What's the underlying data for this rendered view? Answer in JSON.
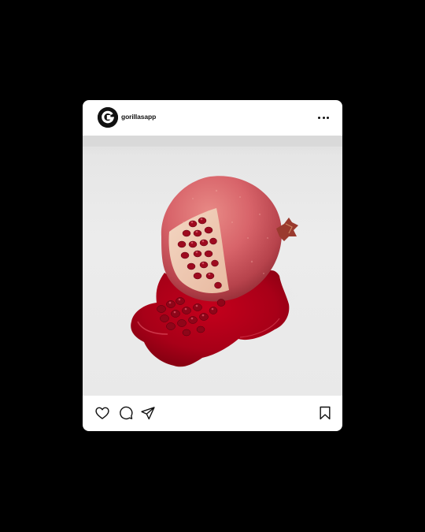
{
  "post": {
    "username": "gorillasapp",
    "avatar_letter": "G",
    "more_icon": "more-horizontal-icon",
    "photo_subject": "pomegranate",
    "actions": {
      "like_icon": "heart-icon",
      "comment_icon": "comment-icon",
      "share_icon": "send-icon",
      "save_icon": "bookmark-icon"
    }
  },
  "colors": {
    "background": "#000000",
    "card": "#ffffff",
    "accent_red": "#b3001b"
  }
}
